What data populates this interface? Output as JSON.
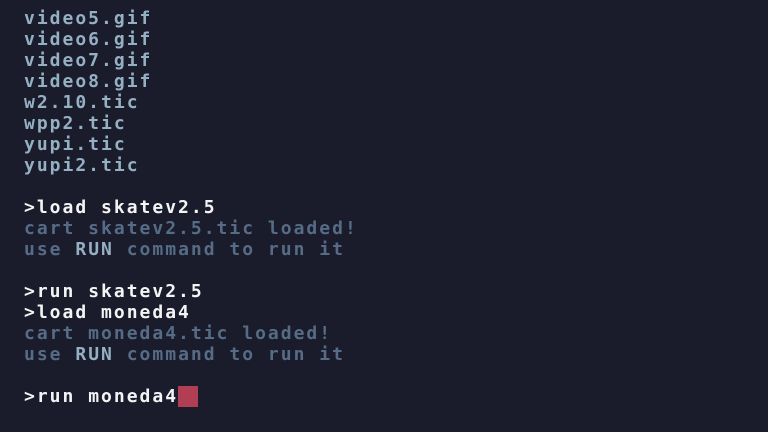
{
  "colors": {
    "background": "#1a1c2c",
    "file_text": "#94b0c2",
    "command_text": "#f4f4f4",
    "output_text": "#94b0c2",
    "output_dim_text": "#566c86",
    "cursor": "#b13e53"
  },
  "file_list": [
    "video5.gif",
    "video6.gif",
    "video7.gif",
    "video8.gif",
    "w2.10.tic",
    "wpp2.tic",
    "yupi.tic",
    "yupi2.tic"
  ],
  "prompt_symbol": ">",
  "commands": {
    "load_skate": "load skatev2.5",
    "run_skate": "run skatev2.5",
    "load_moneda": "load moneda4",
    "run_moneda": "run moneda4"
  },
  "output": {
    "skate_cart": "cart skatev2.5.tic",
    "skate_loaded": "loaded!",
    "moneda_cart": "cart moneda4.tic",
    "moneda_loaded": "loaded!",
    "use_word": "use",
    "run_keyword": "RUN",
    "command_phrase": "command to run it"
  }
}
